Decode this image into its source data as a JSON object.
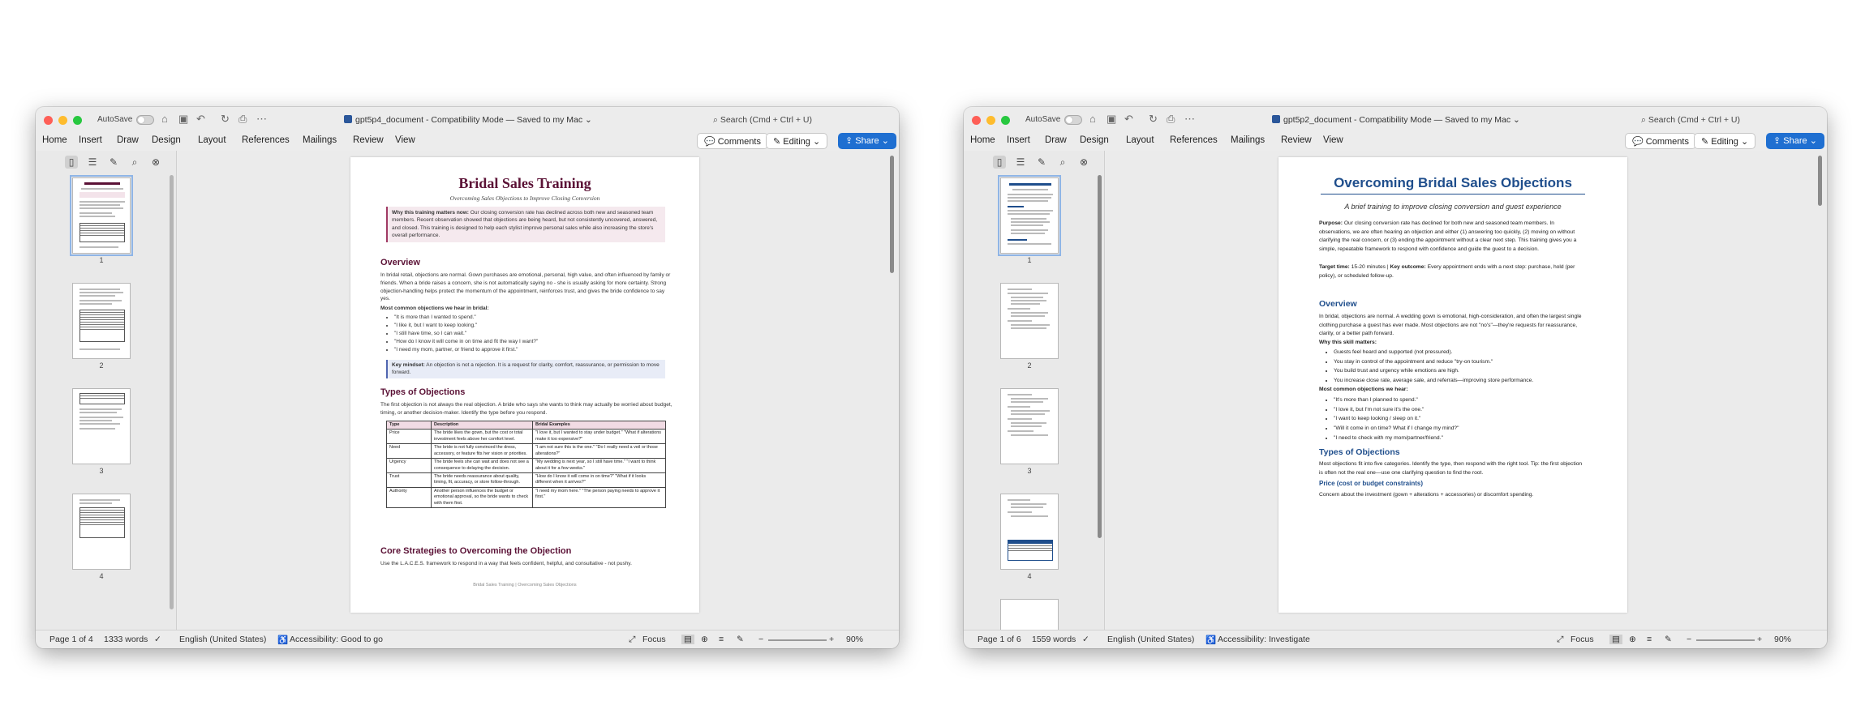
{
  "windows": [
    {
      "autosave_label": "AutoSave",
      "doc_name": "gpt5p4_document",
      "title_rest": " -  Compatibility Mode — Saved to my Mac ⌄",
      "search_label": "Search (Cmd + Ctrl + U)",
      "tabs": [
        "Home",
        "Insert",
        "Draw",
        "Design",
        "Layout",
        "References",
        "Mailings",
        "Review",
        "View"
      ],
      "comments_label": "Comments",
      "editing_label": "Editing",
      "share_label": "Share",
      "thumb_numbers": [
        "1",
        "2",
        "3",
        "4"
      ],
      "status": {
        "page": "Page 1 of 4",
        "words": "1333 words",
        "language": "English (United States)",
        "accessibility": "Accessibility: Good to go",
        "focus": "Focus",
        "zoom": "90%"
      },
      "doc": {
        "title": "Bridal Sales Training",
        "subtitle": "Overcoming Sales Objections to Improve Closing Conversion",
        "why_label": "Why this training matters now:",
        "why_text": " Our closing conversion rate has declined across both new and seasoned team members. Recent observation showed that objections are being heard, but not consistently uncovered, answered, and closed. This training is designed to help each stylist improve personal sales while also increasing the store's overall performance.",
        "overview_heading": "Overview",
        "overview_text": "In bridal retail, objections are normal. Gown purchases are emotional, personal, high value, and often influenced by family or friends. When a bride raises a concern, she is not automatically saying no - she is usually asking for more certainty. Strong objection-handling helps protect the momentum of the appointment, reinforces trust, and gives the bride confidence to say yes.",
        "common_label": "Most common objections we hear in bridal:",
        "common_items": [
          "\"It is more than I wanted to spend.\"",
          "\"I like it, but I want to keep looking.\"",
          "\"I still have time, so I can wait.\"",
          "\"How do I know it will come in on time and fit the way I want?\"",
          "\"I need my mom, partner, or friend to approve it first.\""
        ],
        "mindset_label": "Key mindset:",
        "mindset_text": " An objection is not a rejection. It is a request for clarity, comfort, reassurance, or permission to move forward.",
        "types_heading": "Types of Objections",
        "types_text": "The first objection is not always the real objection. A bride who says she wants to think may actually be worried about budget, timing, or another decision-maker. Identify the type before you respond.",
        "table_headers": [
          "Type",
          "Description",
          "Bridal Examples"
        ],
        "table_rows": [
          [
            "Price",
            "The bride likes the gown, but the cost or total investment feels above her comfort level.",
            "\"I love it, but I wanted to stay under budget.\" \"What if alterations make it too expensive?\""
          ],
          [
            "Need",
            "The bride is not fully convinced the dress, accessory, or feature fits her vision or priorities.",
            "\"I am not sure this is the one.\" \"Do I really need a veil or those alterations?\""
          ],
          [
            "Urgency",
            "The bride feels she can wait and does not see a consequence to delaying the decision.",
            "\"My wedding is next year, so I still have time.\" \"I want to think about it for a few weeks.\""
          ],
          [
            "Trust",
            "The bride needs reassurance about quality, timing, fit, accuracy, or store follow-through.",
            "\"How do I know it will come in on time?\" \"What if it looks different when it arrives?\""
          ],
          [
            "Authority",
            "Another person influences the budget or emotional approval, so the bride wants to check with them first.",
            "\"I need my mom here.\" \"The person paying needs to approve it first.\""
          ]
        ],
        "core_heading": "Core Strategies to Overcoming the Objection",
        "core_text": "Use the L.A.C.E.S. framework to respond in a way that feels confident, helpful, and consultative - not pushy.",
        "footer": "Bridal Sales Training | Overcoming Sales Objections"
      }
    },
    {
      "autosave_label": "AutoSave",
      "doc_name": "gpt5p2_document",
      "title_rest": " -  Compatibility Mode — Saved to my Mac ⌄",
      "search_label": "Search (Cmd + Ctrl + U)",
      "tabs": [
        "Home",
        "Insert",
        "Draw",
        "Design",
        "Layout",
        "References",
        "Mailings",
        "Review",
        "View"
      ],
      "comments_label": "Comments",
      "editing_label": "Editing",
      "share_label": "Share",
      "thumb_numbers": [
        "1",
        "2",
        "3",
        "4"
      ],
      "status": {
        "page": "Page 1 of 6",
        "words": "1559 words",
        "language": "English (United States)",
        "accessibility": "Accessibility: Investigate",
        "focus": "Focus",
        "zoom": "90%"
      },
      "doc": {
        "title": "Overcoming Bridal Sales Objections",
        "subtitle": "A brief training to improve closing conversion and guest experience",
        "purpose_label": "Purpose:",
        "purpose_text": " Our closing conversion rate has declined for both new and seasoned team members. In observations, we are often hearing an objection and either (1) answering too quickly, (2) moving on without clarifying the real concern, or (3) ending the appointment without a clear next step. This training gives you a simple, repeatable framework to respond with confidence and guide the guest to a decision.",
        "target_label": "Target time:",
        "target_text": " 15-20 minutes  |  ",
        "outcome_label": "Key outcome:",
        "outcome_text": " Every appointment ends with a next step: purchase, hold (per policy), or scheduled follow-up.",
        "overview_heading": "Overview",
        "overview_text": "In bridal, objections are normal. A wedding gown is emotional, high-consideration, and often the largest single clothing purchase a guest has ever made. Most objections are not \"no's\"—they're requests for reassurance, clarity, or a better path forward.",
        "why_label": "Why this skill matters:",
        "why_items": [
          "Guests feel heard and supported (not pressured).",
          "You stay in control of the appointment and reduce \"try-on tourism.\"",
          "You build trust and urgency while emotions are high.",
          "You increase close rate, average sale, and referrals—improving store performance."
        ],
        "common_label": "Most common objections we hear:",
        "common_items": [
          "\"It's more than I planned to spend.\"",
          "\"I love it, but I'm not sure it's the one.\"",
          "\"I want to keep looking / sleep on it.\"",
          "\"Will it come in on time? What if I change my mind?\"",
          "\"I need to check with my mom/partner/friend.\""
        ],
        "types_heading": "Types of Objections",
        "types_text": "Most objections fit into five categories. Identify the type, then respond with the right tool. Tip: the first objection is often not the real one—use one clarifying question to find the root.",
        "price_heading": "Price (cost or budget constraints)",
        "price_text": "Concern about the investment (gown + alterations + accessories) or discomfort spending."
      }
    }
  ]
}
